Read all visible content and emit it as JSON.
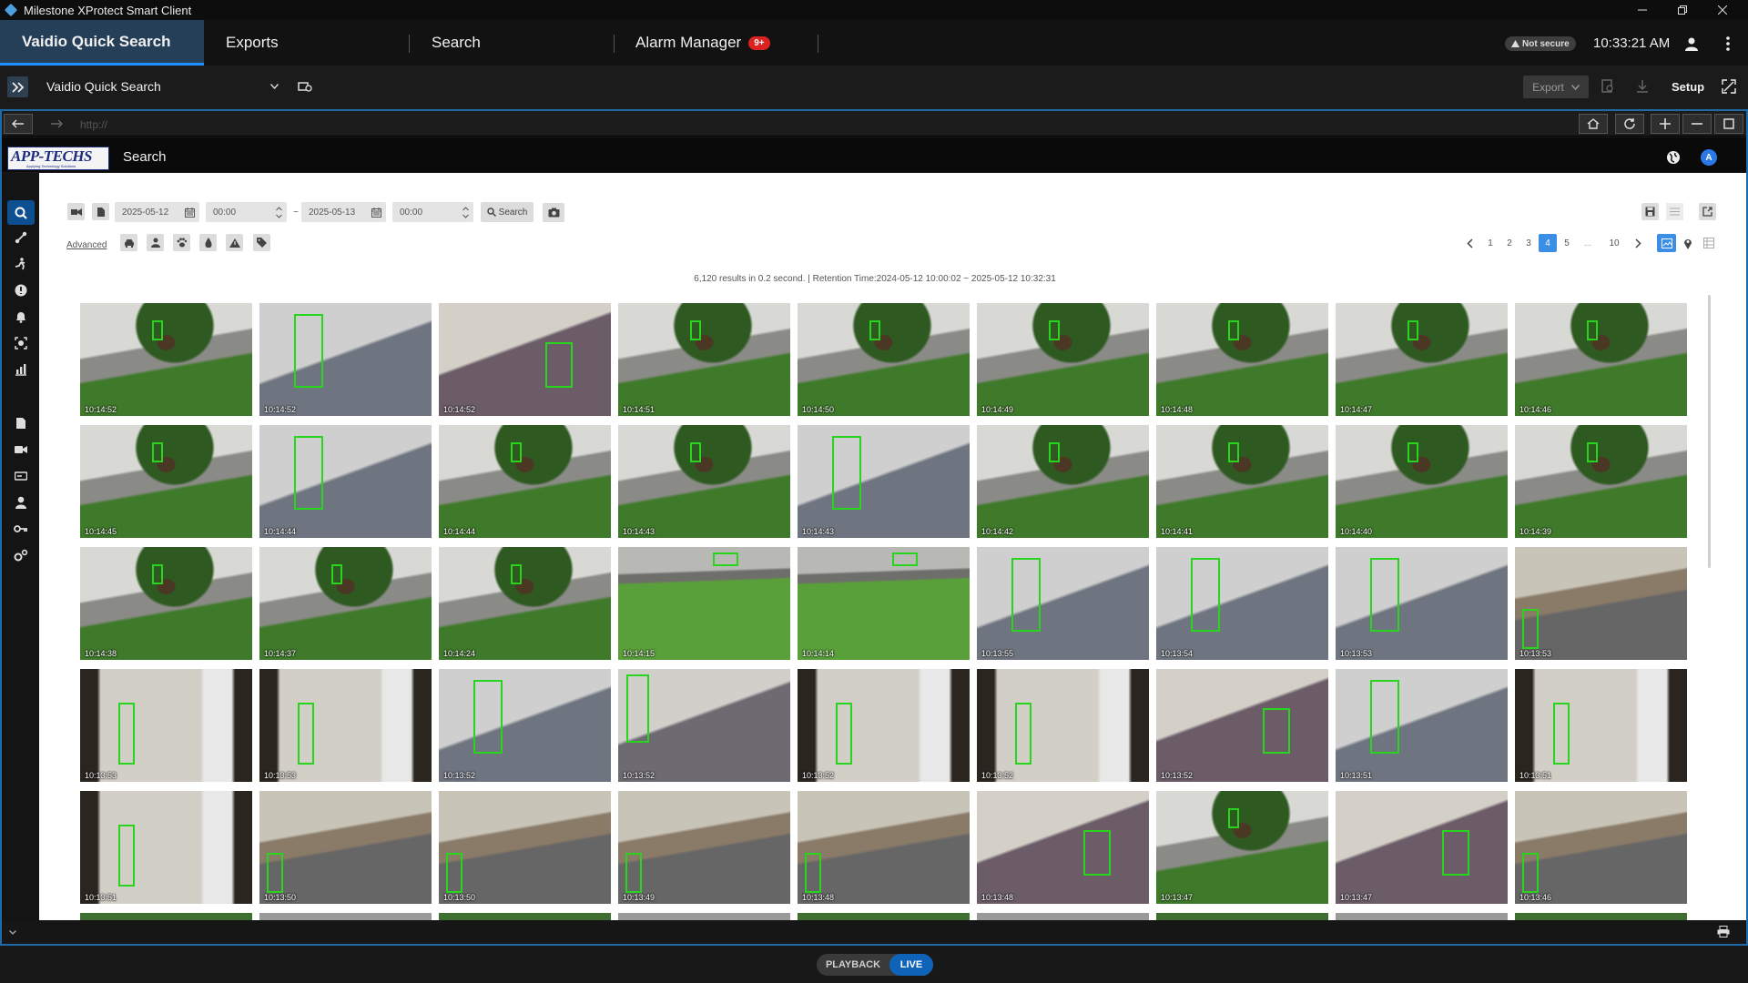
{
  "window": {
    "title": "Milestone XProtect Smart Client"
  },
  "main_tabs": {
    "tab1": "Vaidio Quick Search",
    "tab2": "Exports",
    "tab3": "Search",
    "tab4": "Alarm Manager",
    "alarm_badge": "9+"
  },
  "status": {
    "security": "Not secure",
    "clock": "10:33:21 AM"
  },
  "toolbar": {
    "view_name": "Vaidio Quick Search",
    "export_label": "Export",
    "setup_label": "Setup"
  },
  "browser": {
    "url": "http://"
  },
  "app": {
    "title": "Search",
    "logo_text": "APP-TECHS",
    "logo_tagline": "Applying Technology Solutions",
    "avatar": "A"
  },
  "filters": {
    "start_date": "2025-05-12",
    "start_time": "00:00",
    "separator": "~",
    "end_date": "2025-05-13",
    "end_time": "00:00",
    "search_label": "Search",
    "advanced_label": "Advanced"
  },
  "pagination": {
    "pages": [
      "1",
      "2",
      "3",
      "4",
      "5",
      "...",
      "10"
    ],
    "current": "4"
  },
  "summary": "6,120 results in 0.2 second. | Retention Time:2024-05-12 10:00:02 ~ 2025-05-12 10:32:31",
  "results": [
    {
      "time": "10:14:52",
      "scene": "yard"
    },
    {
      "time": "10:14:52",
      "scene": "hall"
    },
    {
      "time": "10:14:52",
      "scene": "desk"
    },
    {
      "time": "10:14:51",
      "scene": "yard"
    },
    {
      "time": "10:14:50",
      "scene": "yard"
    },
    {
      "time": "10:14:49",
      "scene": "yard"
    },
    {
      "time": "10:14:48",
      "scene": "yard"
    },
    {
      "time": "10:14:47",
      "scene": "yard"
    },
    {
      "time": "10:14:46",
      "scene": "yard"
    },
    {
      "time": "10:14:45",
      "scene": "yard"
    },
    {
      "time": "10:14:44",
      "scene": "hall"
    },
    {
      "time": "10:14:44",
      "scene": "yard"
    },
    {
      "time": "10:14:43",
      "scene": "yard"
    },
    {
      "time": "10:14:43",
      "scene": "hall"
    },
    {
      "time": "10:14:42",
      "scene": "yard"
    },
    {
      "time": "10:14:41",
      "scene": "yard"
    },
    {
      "time": "10:14:40",
      "scene": "yard"
    },
    {
      "time": "10:14:39",
      "scene": "yard"
    },
    {
      "time": "10:14:38",
      "scene": "yard"
    },
    {
      "time": "10:14:37",
      "scene": "yard"
    },
    {
      "time": "10:14:24",
      "scene": "yard"
    },
    {
      "time": "10:14:15",
      "scene": "lawn"
    },
    {
      "time": "10:14:14",
      "scene": "lawn"
    },
    {
      "time": "10:13:55",
      "scene": "hall"
    },
    {
      "time": "10:13:54",
      "scene": "hall"
    },
    {
      "time": "10:13:53",
      "scene": "hall"
    },
    {
      "time": "10:13:53",
      "scene": "office"
    },
    {
      "time": "10:13:53",
      "scene": "door"
    },
    {
      "time": "10:13:53",
      "scene": "door"
    },
    {
      "time": "10:13:52",
      "scene": "hall"
    },
    {
      "time": "10:13:52",
      "scene": "room"
    },
    {
      "time": "10:13:52",
      "scene": "door"
    },
    {
      "time": "10:13:52",
      "scene": "door"
    },
    {
      "time": "10:13:52",
      "scene": "desk"
    },
    {
      "time": "10:13:51",
      "scene": "hall"
    },
    {
      "time": "10:13:51",
      "scene": "door"
    },
    {
      "time": "10:13:51",
      "scene": "door"
    },
    {
      "time": "10:13:50",
      "scene": "office"
    },
    {
      "time": "10:13:50",
      "scene": "office"
    },
    {
      "time": "10:13:49",
      "scene": "office"
    },
    {
      "time": "10:13:48",
      "scene": "office"
    },
    {
      "time": "10:13:48",
      "scene": "desk"
    },
    {
      "time": "10:13:47",
      "scene": "yard"
    },
    {
      "time": "10:13:47",
      "scene": "desk"
    },
    {
      "time": "10:13:46",
      "scene": "office"
    }
  ],
  "bottom": {
    "playback_label": "PLAYBACK",
    "live_label": "LIVE"
  },
  "colors": {
    "accent": "#1e90ff",
    "detection_box": "#29d41f",
    "active_page": "#3b8ee5",
    "alarm": "#dd2222"
  }
}
